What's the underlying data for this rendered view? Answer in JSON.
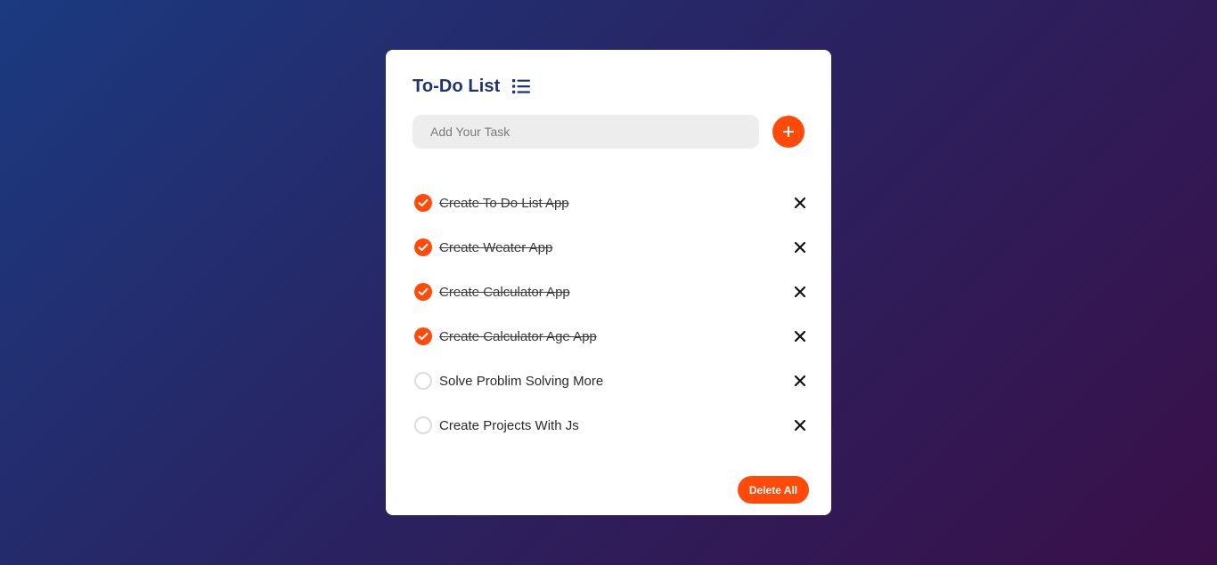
{
  "app": {
    "title": "To-Do List",
    "title_icon": "list-icon",
    "accent_color": "#ff4a0a",
    "title_color": "#1e3370"
  },
  "input": {
    "placeholder": "Add Your Task",
    "value": "",
    "add_icon": "plus-icon",
    "add_label": "+"
  },
  "tasks": [
    {
      "text": "Create To Do List App",
      "done": true
    },
    {
      "text": "Create Weater App",
      "done": true
    },
    {
      "text": "Create Calculator App",
      "done": true
    },
    {
      "text": "Create Calculator Age App",
      "done": true
    },
    {
      "text": "Solve Problim Solving More",
      "done": false
    },
    {
      "text": "Create Projects With Js",
      "done": false
    }
  ],
  "footer": {
    "delete_all_label": "Delete All"
  }
}
